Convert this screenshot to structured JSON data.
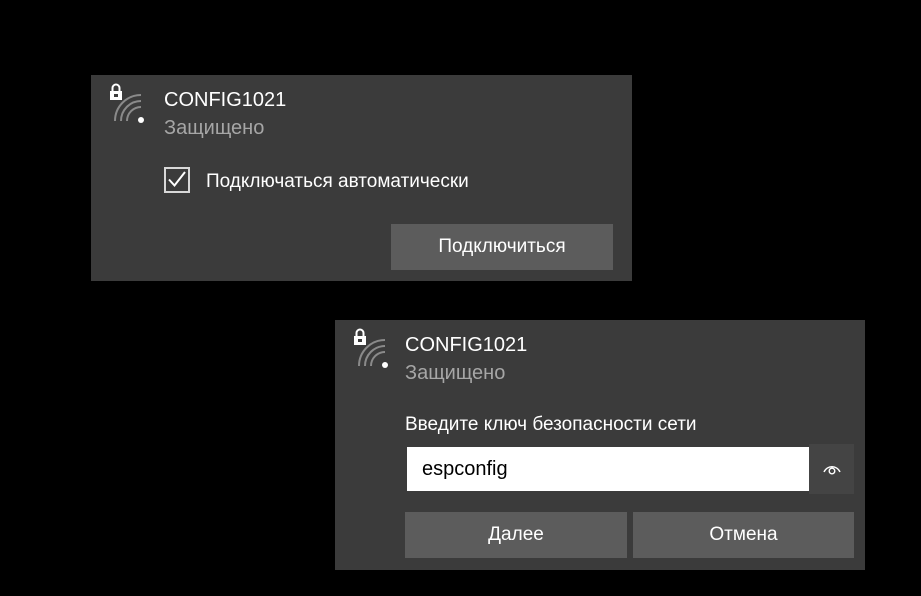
{
  "connect_panel": {
    "network_name": "CONFIG1021",
    "security_status": "Защищено",
    "auto_connect_label": "Подключаться автоматически",
    "auto_connect_checked": true,
    "connect_button": "Подключиться",
    "icons": [
      "lock-icon",
      "wifi-signal-icon",
      "checkmark-icon"
    ]
  },
  "key_panel": {
    "network_name": "CONFIG1021",
    "security_status": "Защищено",
    "key_prompt": "Введите ключ безопасности сети",
    "key_value": "espconfig",
    "next_button": "Далее",
    "cancel_button": "Отмена",
    "icons": [
      "lock-icon",
      "wifi-signal-icon",
      "reveal-password-icon"
    ]
  },
  "colors": {
    "background": "#000000",
    "panel": "#3b3b3b",
    "button": "#5c5c5c",
    "secondary_text": "#a6a6a6"
  }
}
